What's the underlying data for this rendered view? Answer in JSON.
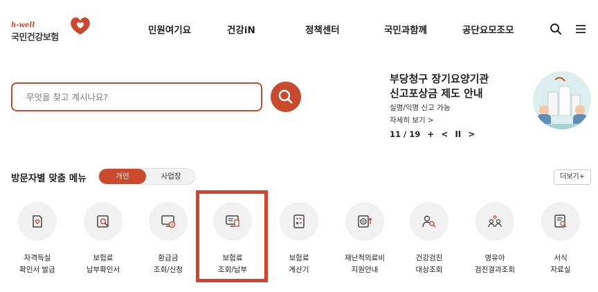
{
  "header": {
    "logo_small": "h-well",
    "logo_name": "국민건강보험",
    "nav": [
      "민원여기요",
      "건강iN",
      "정책센터",
      "국민과함께",
      "공단요모조모"
    ],
    "icons": [
      "search-icon",
      "menu-icon"
    ]
  },
  "search": {
    "placeholder": "무엇을 찾고 계시나요?"
  },
  "banner": {
    "title_line1": "부당청구 장기요양기관",
    "title_line2": "신고포상금 제도 안내",
    "subtitle": "실명/익명 신고 가능",
    "more": "자세히 보기 >",
    "page": "11 / 19",
    "add": "+",
    "prev": "<",
    "pause": "II",
    "next": ">"
  },
  "visitor": {
    "title": "방문자별 맞춤 메뉴",
    "tab_personal": "개인",
    "tab_business": "사업장",
    "more": "더보기+"
  },
  "menu": [
    {
      "line1": "자격득실",
      "line2": "확인서 발급",
      "icon": "certificate-heart-icon"
    },
    {
      "line1": "보험료",
      "line2": "납부확인서",
      "icon": "document-search-icon"
    },
    {
      "line1": "환급금",
      "line2": "조회/신청",
      "icon": "monitor-won-icon"
    },
    {
      "line1": "보험료",
      "line2": "조회/납부",
      "icon": "monitor-document-icon"
    },
    {
      "line1": "보험료",
      "line2": "계산기",
      "icon": "calculator-icon"
    },
    {
      "line1": "재난적의료비",
      "line2": "지원안내",
      "icon": "won-increase-icon"
    },
    {
      "line1": "건강검진",
      "line2": "대상조회",
      "icon": "people-search-icon"
    },
    {
      "line1": "영유아",
      "line2": "검진결과조회",
      "icon": "children-heart-icon"
    },
    {
      "line1": "서식",
      "line2": "자료실",
      "icon": "form-search-icon"
    }
  ],
  "colors": {
    "accent": "#c9492d",
    "highlight": "#d4432a"
  }
}
